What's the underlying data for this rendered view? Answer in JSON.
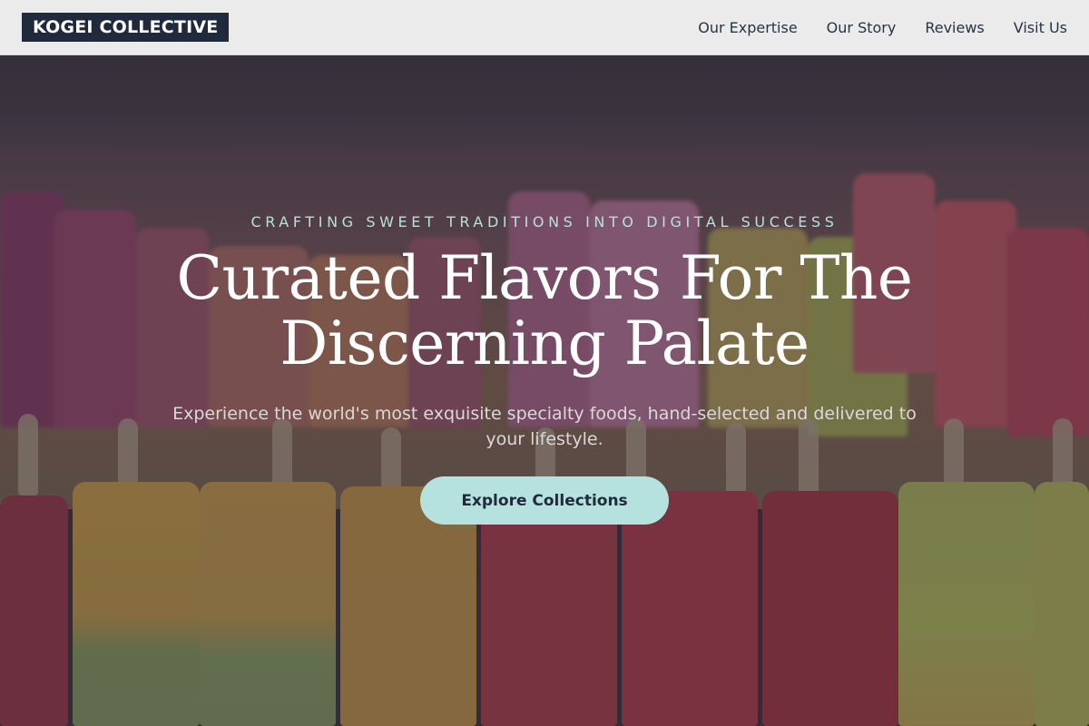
{
  "header": {
    "logo": "KOGEI COLLECTIVE",
    "nav": [
      {
        "label": "Our Expertise"
      },
      {
        "label": "Our Story"
      },
      {
        "label": "Reviews"
      },
      {
        "label": "Visit Us"
      }
    ]
  },
  "hero": {
    "eyebrow": "CRAFTING SWEET TRADITIONS INTO DIGITAL SUCCESS",
    "headline_line1": "Curated Flavors For The",
    "headline_line2": "Discerning Palate",
    "subtext": "Experience the world's most exquisite specialty foods, hand-selected and delivered to your lifestyle.",
    "cta_label": "Explore Collections"
  },
  "colors": {
    "header_bg": "#ebebec",
    "logo_bg": "#1f2a3c",
    "accent": "#b5e2de",
    "eyebrow": "#b9e0dc",
    "nav_text": "#2a3344"
  }
}
